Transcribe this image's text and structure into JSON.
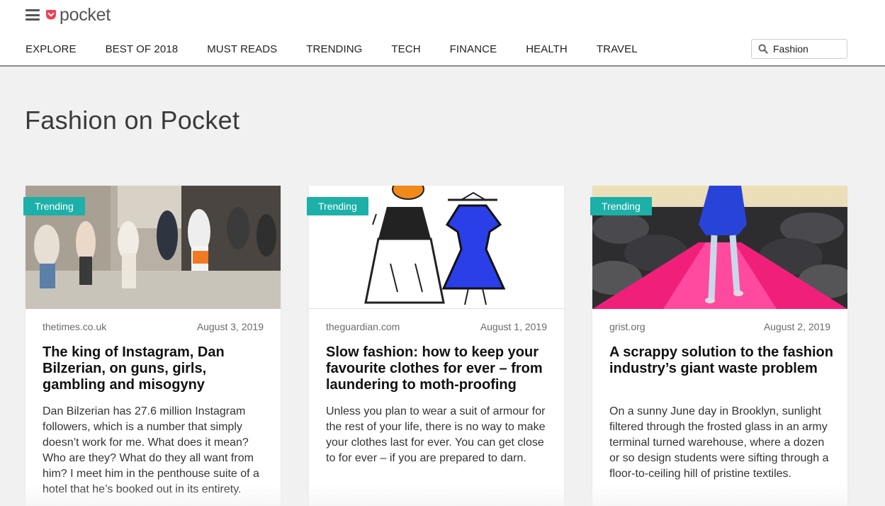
{
  "header": {
    "logo_text": "pocket",
    "brand_color": "#ef4056",
    "nav": [
      {
        "label": "EXPLORE"
      },
      {
        "label": "BEST OF 2018"
      },
      {
        "label": "MUST READS"
      },
      {
        "label": "TRENDING"
      },
      {
        "label": "TECH"
      },
      {
        "label": "FINANCE"
      },
      {
        "label": "HEALTH"
      },
      {
        "label": "TRAVEL"
      }
    ],
    "search": {
      "value": "Fashion"
    }
  },
  "main": {
    "title": "Fashion on Pocket",
    "accent_color": "#1cb0a8",
    "cards": [
      {
        "badge": "Trending",
        "source": "thetimes.co.uk",
        "date": "August 3, 2019",
        "title": "The king of Instagram, Dan Bilzerian, on guns, girls, gambling and misogyny",
        "excerpt": "Dan Bilzerian has 27.6 million Instagram followers, which is a number that simply doesn’t work for me. What does it mean? Who are they? What do they all want from him? I meet him in the penthouse suite of a hotel that he’s booked out in its entirety."
      },
      {
        "badge": "Trending",
        "source": "theguardian.com",
        "date": "August 1, 2019",
        "title": "Slow fashion: how to keep your favourite clothes for ever – from laundering to moth-proofing",
        "excerpt": "Unless you plan to wear a suit of armour for the rest of your life, there is no way to make your clothes last for ever. You can get close to for ever – if you are prepared to darn."
      },
      {
        "badge": "Trending",
        "source": "grist.org",
        "date": "August 2, 2019",
        "title": "A scrappy solution to the fashion industry’s giant waste problem",
        "excerpt": "On a sunny June day in Brooklyn, sunlight filtered through the frosted glass in an army terminal turned warehouse, where a dozen or so design students were sifting through a floor-to-ceiling hill of pristine textiles."
      }
    ]
  }
}
